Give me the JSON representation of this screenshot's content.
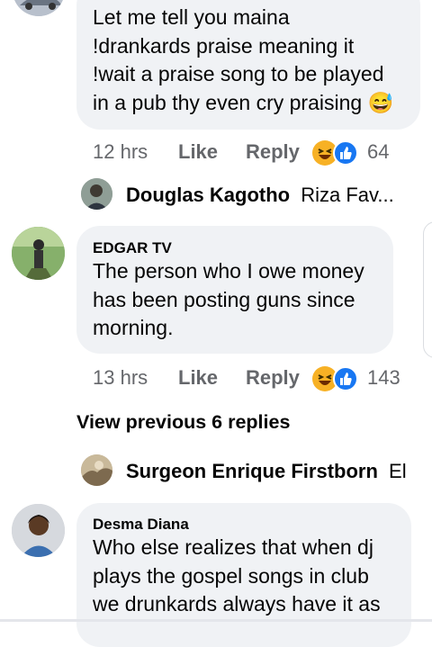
{
  "comment1": {
    "lines": [
      "Let me tell you maina",
      "!drankards praise meaning it",
      "!wait a praise song to be played",
      "in a pub thy even cry praising"
    ],
    "emoji": "😅",
    "time": "12 hrs",
    "like_label": "Like",
    "reply_label": "Reply",
    "reaction_count": "64"
  },
  "reply_preview1": {
    "name": "Douglas Kagotho",
    "preview": "Riza Fav..."
  },
  "comment2": {
    "author": "EDGAR TV",
    "lines": [
      "The person who I owe money",
      "has been posting guns since",
      "morning."
    ],
    "time": "13 hrs",
    "like_label": "Like",
    "reply_label": "Reply",
    "reaction_count": "143"
  },
  "view_previous": "View previous 6 replies",
  "reply_preview2": {
    "name": "Surgeon Enrique Firstborn",
    "preview": "El"
  },
  "comment3": {
    "author": "Desma Diana",
    "lines": [
      "Who else realizes that when dj",
      "plays the gospel songs in club",
      "we drunkards always have it as"
    ]
  },
  "colors": {
    "bubble": "#f0f2f5",
    "meta": "#65676b",
    "like_blue": "#1877f2",
    "laugh_yellow": "#f7b125"
  }
}
